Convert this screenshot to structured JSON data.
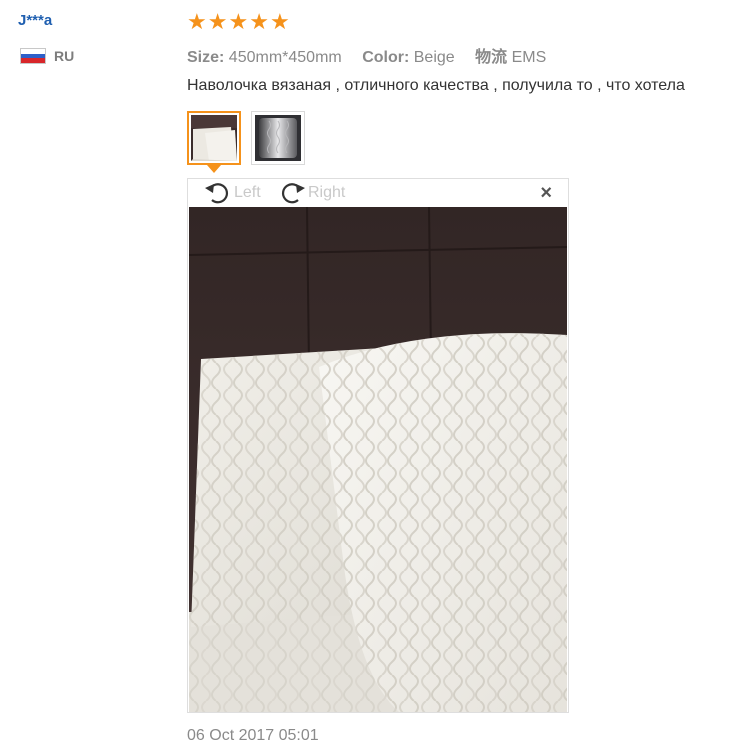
{
  "user": {
    "name": "J***a",
    "country_code": "RU",
    "flag_icon": "russia-flag-icon"
  },
  "review": {
    "rating": 5,
    "stars": [
      "★",
      "★",
      "★",
      "★",
      "★"
    ],
    "size_label": "Size:",
    "size_value": "450mm*450mm",
    "color_label": "Color:",
    "color_value": "Beige",
    "shipping_label": "物流",
    "shipping_value": "EMS",
    "text": "Наволочка вязаная , отличного качества , получила то , что хотела",
    "date": "06 Oct 2017 05:01"
  },
  "viewer": {
    "rotate_left_label": "Left",
    "rotate_right_label": "Right",
    "close_label": "×",
    "thumbnails": [
      "thumbnail-1",
      "thumbnail-2"
    ],
    "active_thumbnail": 1
  },
  "colors": {
    "accent": "#f5921b",
    "link": "#1f5fb0",
    "muted": "#8a8a8a"
  }
}
